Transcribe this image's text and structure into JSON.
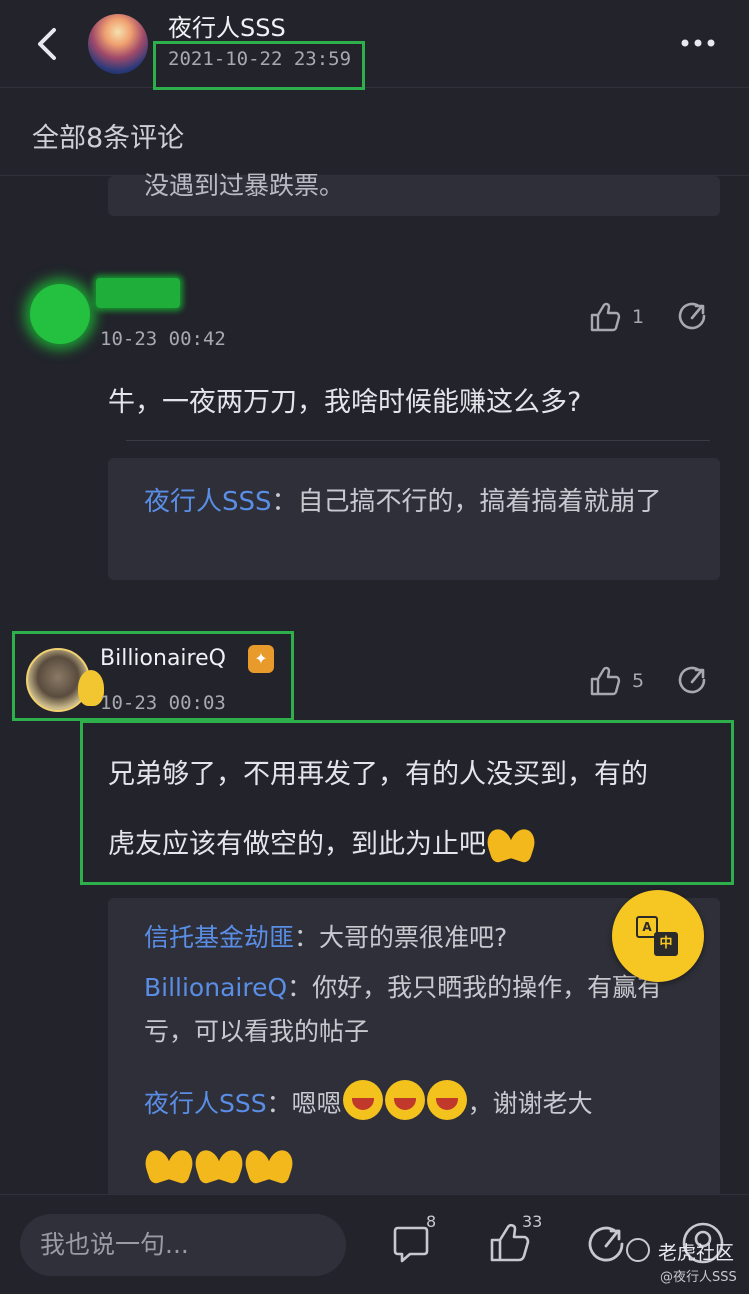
{
  "header": {
    "author_name": "夜行人SSS",
    "post_time": "2021-10-22 23:59",
    "back_glyph": "‹",
    "more_glyph": "•••"
  },
  "section": {
    "comments_label": "全部8条评论"
  },
  "prev_reply": {
    "text": "没遇到过暴跌票。"
  },
  "comment1": {
    "time": "10-23 00:42",
    "like_count": "1",
    "text": "牛，一夜两万刀，我啥时候能赚这么多?",
    "reply": {
      "user": "夜行人SSS",
      "text": "：自己搞不行的，搞着搞着就崩了"
    }
  },
  "comment2": {
    "user": "BillionaireQ",
    "badge": "✦",
    "time": "10-23 00:03",
    "like_count": "5",
    "text_line1": "兄弟够了，不用再发了，有的人没买到，有的",
    "text_line2": "虎友应该有做空的，到此为止吧",
    "replies": [
      {
        "user": "信托基金劫匪",
        "text": "：大哥的票很准吧?"
      },
      {
        "user": "BillionaireQ",
        "text": "：你好，我只晒我的操作，有赢有亏，可以看我的帖子"
      },
      {
        "user": "夜行人SSS",
        "text_before": "：嗯嗯",
        "text_after": "，谢谢老大"
      }
    ]
  },
  "translate": {
    "a": "A",
    "b": "中"
  },
  "bottom": {
    "input_placeholder": "我也说一句...",
    "comment_count": "8",
    "like_count": "33"
  },
  "watermark": {
    "brand": "老虎社区",
    "user": "@夜行人SSS"
  },
  "colors": {
    "background": "#22232b",
    "highlight": "#2db04b",
    "username": "#5a8ee6",
    "translate_button": "#f6c623"
  }
}
